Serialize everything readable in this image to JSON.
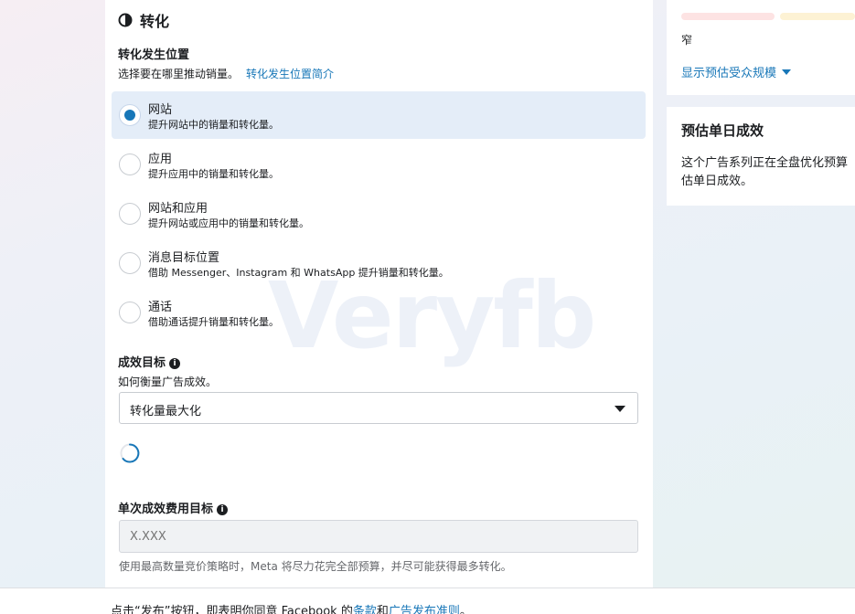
{
  "section": {
    "title": "转化",
    "icon": "half-circle-icon"
  },
  "conversion_location": {
    "label": "转化发生位置",
    "description": "选择要在哪里推动销量。",
    "link": "转化发生位置简介",
    "options": [
      {
        "title": "网站",
        "desc": "提升网站中的销量和转化量。",
        "selected": true
      },
      {
        "title": "应用",
        "desc": "提升应用中的销量和转化量。",
        "selected": false
      },
      {
        "title": "网站和应用",
        "desc": "提升网站或应用中的销量和转化量。",
        "selected": false
      },
      {
        "title": "消息目标位置",
        "desc": "借助 Messenger、Instagram 和 WhatsApp 提升销量和转化量。",
        "selected": false
      },
      {
        "title": "通话",
        "desc": "借助通话提升销量和转化量。",
        "selected": false
      }
    ]
  },
  "performance_goal": {
    "label": "成效目标",
    "description": "如何衡量广告成效。",
    "selected_value": "转化量最大化"
  },
  "cost_goal": {
    "label": "单次成效费用目标",
    "placeholder": "X.XXX",
    "hint": "使用最高数量竞价策略时，Meta 将尽力花完全部预算，并尽可能获得最多转化。"
  },
  "audience": {
    "narrow_label": "窄",
    "show_estimate": "显示预估受众规模"
  },
  "daily_results": {
    "title": "预估单日成效",
    "body_line1": "这个广告系列正在全盘优化预算",
    "body_line2": "估单日成效。"
  },
  "watermark": "Veryfb",
  "footer": {
    "prefix": "点击“发布”按钮，即表明你同意 Facebook 的",
    "terms": "条款",
    "and": "和",
    "guidelines": "广告发布准则",
    "suffix": "。"
  },
  "colors": {
    "accent": "#1877b8",
    "selected_bg": "#e4edf8"
  }
}
